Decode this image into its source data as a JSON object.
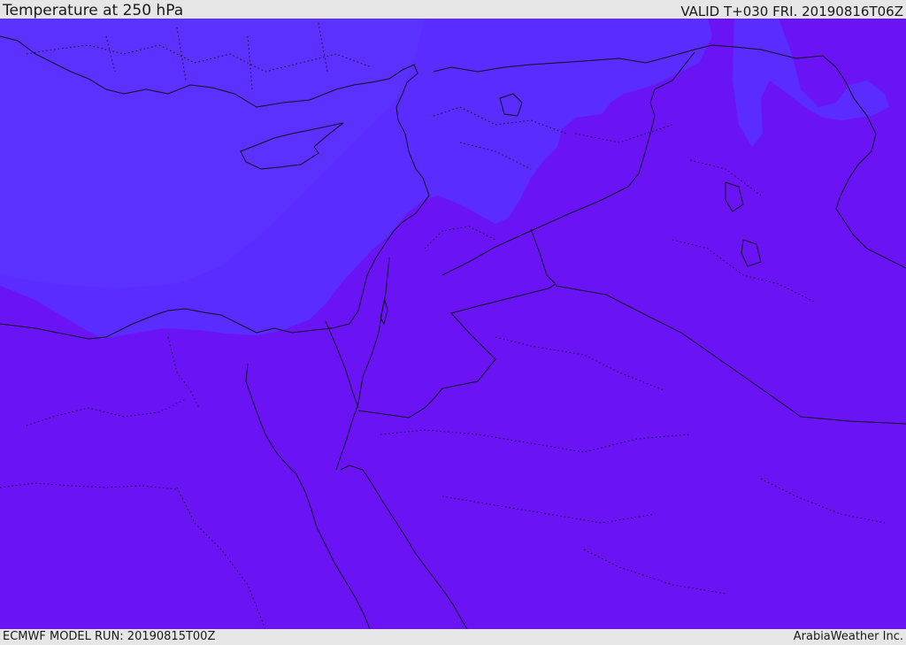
{
  "header": {
    "title": "Temperature at 250 hPa",
    "valid_label": "VALID T+030 FRI. 20190816T06Z"
  },
  "footer": {
    "model_run": "ECMWF MODEL RUN: 20190815T00Z",
    "credit": "ArabiaWeather Inc."
  },
  "colors": {
    "field_warm": "#6a14f6",
    "field_cool": "#5a2cff",
    "field_cool_light": "#5c3cff",
    "coastline": "#101020",
    "frame_background": "#e6e6e6"
  }
}
